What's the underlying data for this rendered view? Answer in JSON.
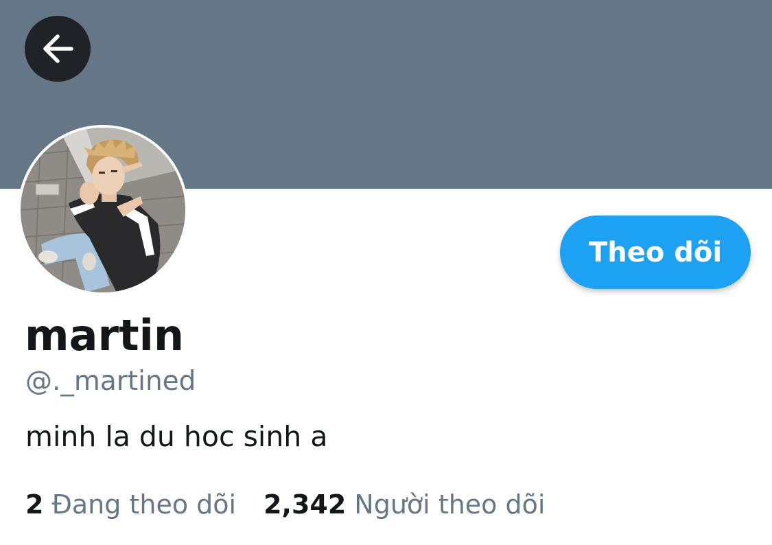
{
  "profile": {
    "display_name": "martin",
    "handle": "@._martined",
    "bio": "minh la du hoc sinh a",
    "follow_label": "Theo dõi"
  },
  "stats": {
    "following_count": "2",
    "following_label": "Đang theo dõi",
    "followers_count": "2,342",
    "followers_label": "Người theo dõi"
  },
  "icons": {
    "back": "arrow-left-icon"
  },
  "colors": {
    "banner": "#657786",
    "accent": "#1da1f2",
    "text_primary": "#14171a",
    "text_secondary": "#657786",
    "back_button_bg": "#1f2327"
  }
}
